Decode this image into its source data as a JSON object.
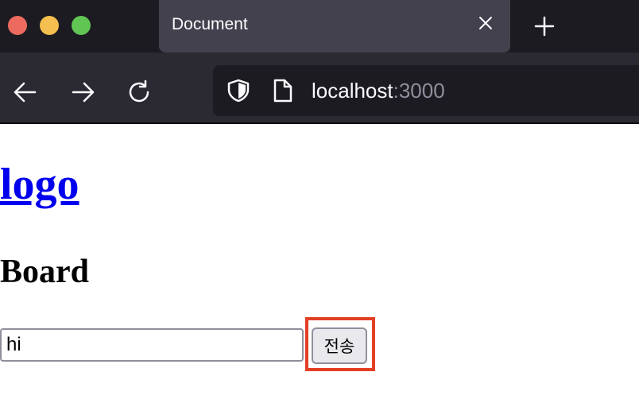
{
  "browser": {
    "tab_title": "Document",
    "url_host": "localhost",
    "url_port": ":3000"
  },
  "page": {
    "logo_text": "logo",
    "heading": "Board",
    "input_value": "hi",
    "submit_label": "전송"
  },
  "colors": {
    "chrome_bg": "#1c1b22",
    "tab_active": "#42414d",
    "link": "#0000ee",
    "highlight": "#e23f25"
  },
  "icons": [
    "close-icon",
    "plus-icon",
    "back-arrow-icon",
    "forward-arrow-icon",
    "reload-icon",
    "shield-icon",
    "page-icon"
  ]
}
